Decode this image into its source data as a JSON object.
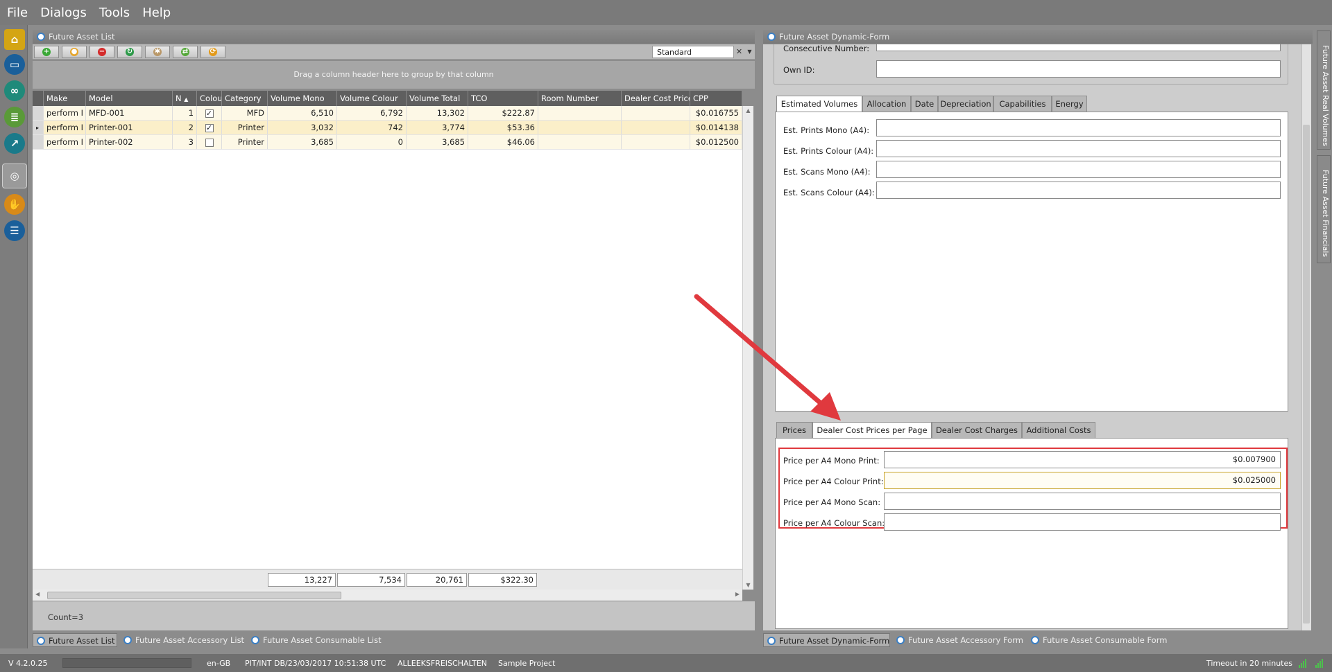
{
  "menu": [
    "File",
    "Dialogs",
    "Tools",
    "Help"
  ],
  "left_panel": {
    "title": "Future Asset List",
    "view_select": "Standard",
    "view_clear": "✕",
    "group_hint": "Drag a column header here to group by that column",
    "columns": [
      "Make",
      "Model",
      "N",
      "Colou",
      "Category",
      "Volume Mono",
      "Volume Colour",
      "Volume Total",
      "TCO",
      "Room Number",
      "Dealer Cost Price",
      "CPP"
    ],
    "rows": [
      {
        "make": "perform I",
        "model": "MFD-001",
        "n": "1",
        "colour": "✓",
        "category": "MFD",
        "vol_mono": "6,510",
        "vol_colour": "6,792",
        "vol_total": "13,302",
        "tco": "$222.87",
        "room": "",
        "dealer": "",
        "cpp": "$0.016755"
      },
      {
        "make": "perform I",
        "model": "Printer-001",
        "n": "2",
        "colour": "✓",
        "category": "Printer",
        "vol_mono": "3,032",
        "vol_colour": "742",
        "vol_total": "3,774",
        "tco": "$53.36",
        "room": "",
        "dealer": "",
        "cpp": "$0.014138"
      },
      {
        "make": "perform I",
        "model": "Printer-002",
        "n": "3",
        "colour": "",
        "category": "Printer",
        "vol_mono": "3,685",
        "vol_colour": "0",
        "vol_total": "3,685",
        "tco": "$46.06",
        "room": "",
        "dealer": "",
        "cpp": "$0.012500"
      }
    ],
    "totals": {
      "vol_mono": "13,227",
      "vol_colour": "7,534",
      "vol_total": "20,761",
      "tco": "$322.30"
    },
    "count": "Count=3"
  },
  "left_bottom_tabs": [
    "Future Asset List",
    "Future Asset Accessory List",
    "Future Asset Consumable List"
  ],
  "right_panel": {
    "title": "Future Asset Dynamic-Form",
    "top_fields": {
      "consecutive": "Consecutive Number:",
      "own_id": "Own ID:"
    },
    "tabs_upper": [
      "Estimated Volumes",
      "Allocation",
      "Date",
      "Depreciation",
      "Capabilities",
      "Energy"
    ],
    "est_fields": [
      "Est. Prints Mono (A4):",
      "Est. Prints Colour (A4):",
      "Est. Scans Mono (A4):",
      "Est. Scans Colour (A4):"
    ],
    "tabs_lower": [
      "Prices",
      "Dealer Cost Prices per Page",
      "Dealer Cost Charges",
      "Additional Costs"
    ],
    "price_fields": [
      {
        "label": "Price per A4 Mono Print:",
        "value": "$0.007900"
      },
      {
        "label": "Price per A4 Colour Print:",
        "value": "$0.025000"
      },
      {
        "label": "Price per A4 Mono Scan:",
        "value": ""
      },
      {
        "label": "Price per A4 Colour Scan:",
        "value": ""
      }
    ]
  },
  "right_bottom_tabs": [
    "Future Asset Dynamic-Form",
    "Future Asset Accessory Form",
    "Future Asset Consumable Form"
  ],
  "side_tabs": [
    "Future Asset Real Volumes",
    "Future Asset Financials"
  ],
  "status": {
    "version": "V 4.2.0.25",
    "locale": "en-GB",
    "db": "PIT/INT DB/23/03/2017 10:51:38 UTC",
    "user": "ALLEEKSFREISCHALTEN",
    "project": "Sample Project",
    "timeout": "Timeout in 20 minutes"
  },
  "colors": {
    "accent_highlight": "#e0393e",
    "row_highlight": "#fbefc9",
    "row_alt": "#fdf8e6"
  }
}
